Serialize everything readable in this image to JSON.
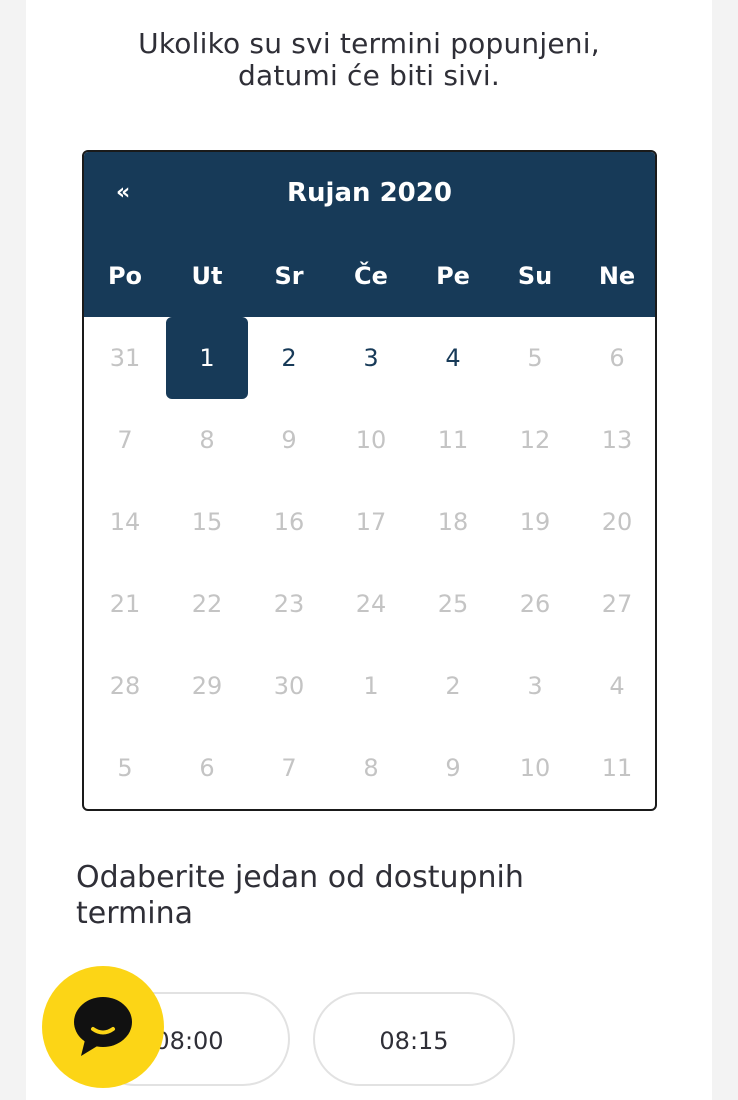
{
  "intro": {
    "line1": "Ukoliko su svi termini popunjeni,",
    "line2": "datumi će biti sivi."
  },
  "calendar": {
    "prev_label": "«",
    "month_title": "Rujan 2020",
    "weekdays": [
      "Po",
      "Ut",
      "Sr",
      "Če",
      "Pe",
      "Su",
      "Ne"
    ],
    "weeks": [
      [
        "31",
        "1",
        "2",
        "3",
        "4",
        "5",
        "6"
      ],
      [
        "7",
        "8",
        "9",
        "10",
        "11",
        "12",
        "13"
      ],
      [
        "14",
        "15",
        "16",
        "17",
        "18",
        "19",
        "20"
      ],
      [
        "21",
        "22",
        "23",
        "24",
        "25",
        "26",
        "27"
      ],
      [
        "28",
        "29",
        "30",
        "1",
        "2",
        "3",
        "4"
      ],
      [
        "5",
        "6",
        "7",
        "8",
        "9",
        "10",
        "11"
      ]
    ],
    "selected_day": "1",
    "available_days": [
      "2",
      "3",
      "4"
    ]
  },
  "slots": {
    "title": "Odaberite jedan od dostupnih termina",
    "times": [
      "08:00",
      "08:15"
    ]
  },
  "chat": {
    "icon": "chat-bubble-icon"
  },
  "colors": {
    "primary": "#173a58",
    "accent": "#fcd516",
    "disabled_text": "#c4c4c4"
  }
}
